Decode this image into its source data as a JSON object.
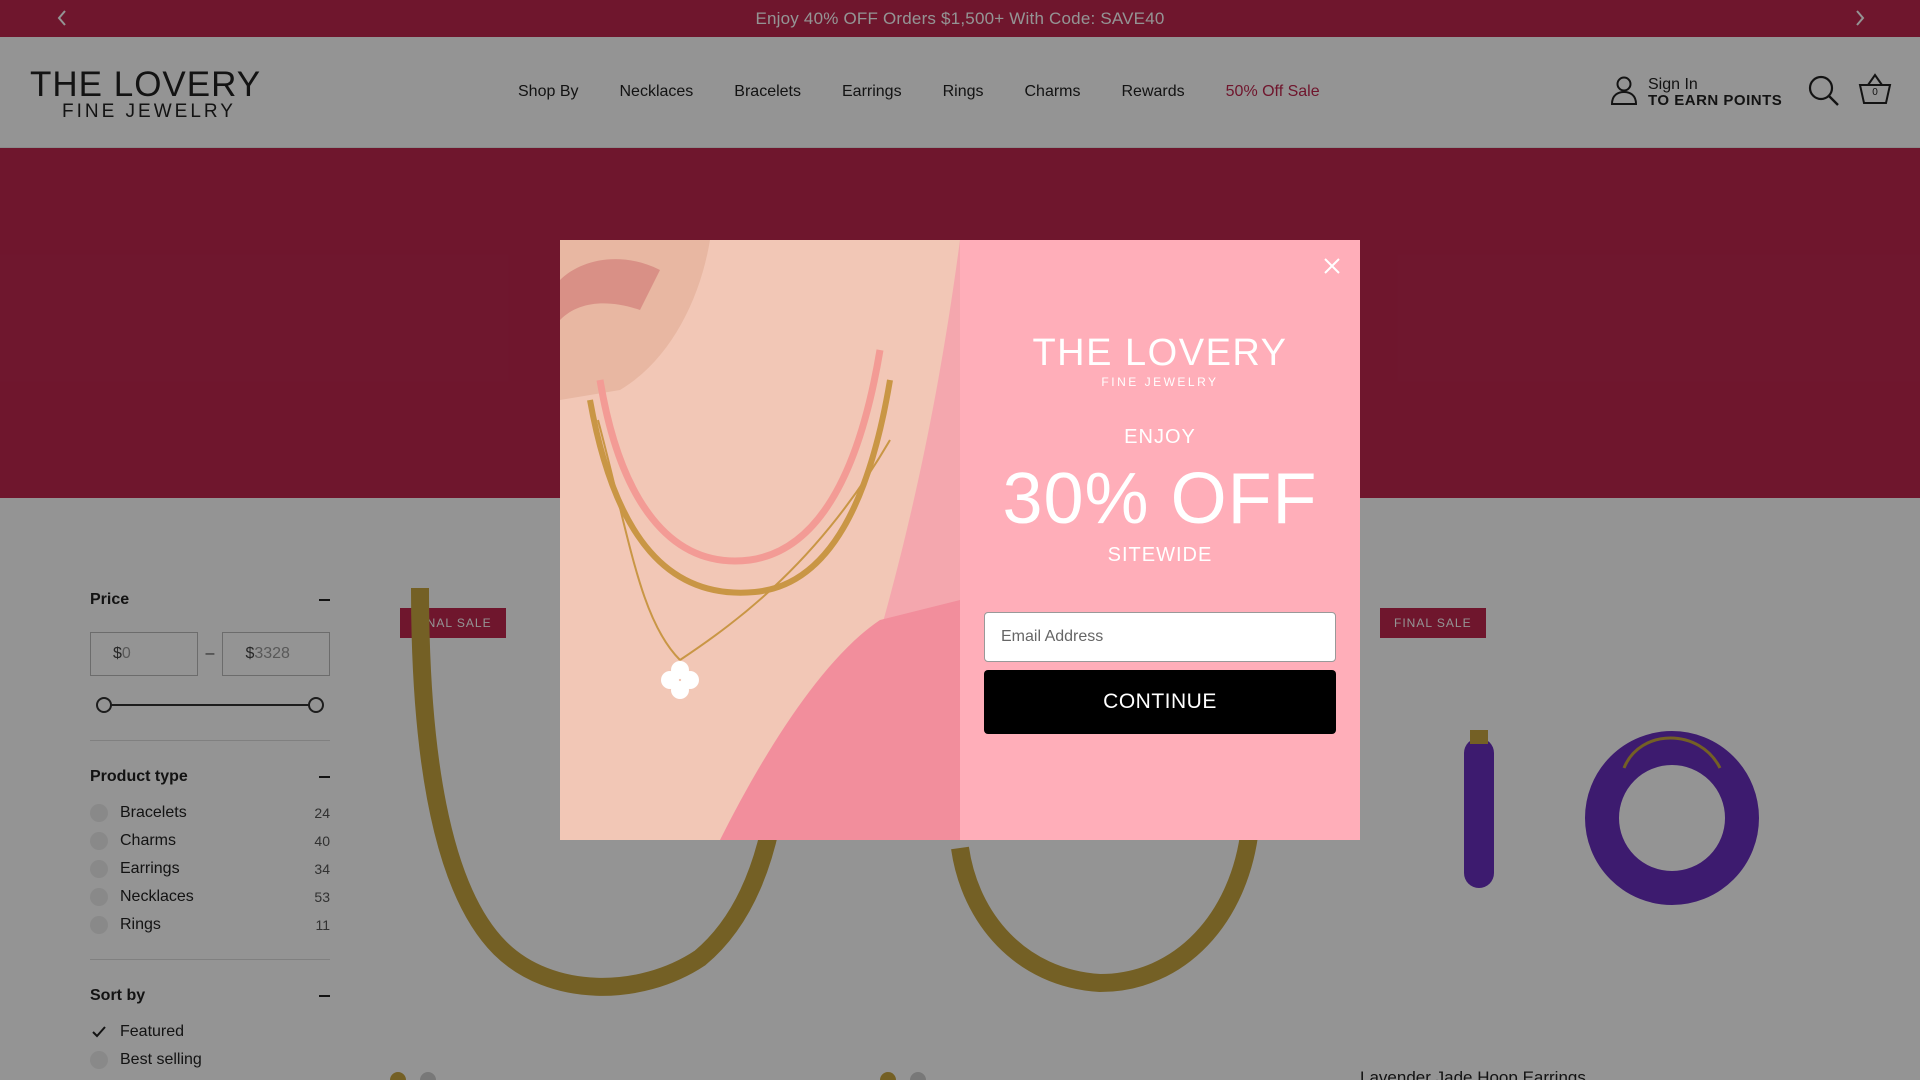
{
  "announcement": {
    "text": "Enjoy 40% OFF Orders $1,500+ With Code: SAVE40",
    "prev_icon": "chevron-left-icon",
    "next_icon": "chevron-right-icon"
  },
  "header": {
    "logo_main": "THE LOVERY",
    "logo_sub": "FINE JEWELRY",
    "nav": [
      {
        "label": "Shop By"
      },
      {
        "label": "Necklaces"
      },
      {
        "label": "Bracelets"
      },
      {
        "label": "Earrings"
      },
      {
        "label": "Rings"
      },
      {
        "label": "Charms"
      },
      {
        "label": "Rewards"
      },
      {
        "label": "50% Off Sale"
      }
    ],
    "account_line1": "Sign In",
    "account_line2": "TO EARN POINTS",
    "cart_count": "0"
  },
  "filters": {
    "price": {
      "title": "Price",
      "currency": "$",
      "min_placeholder": "0",
      "max_placeholder": "3328",
      "separator": "–"
    },
    "product_type": {
      "title": "Product type",
      "options": [
        {
          "label": "Bracelets",
          "count": "24"
        },
        {
          "label": "Charms",
          "count": "40"
        },
        {
          "label": "Earrings",
          "count": "34"
        },
        {
          "label": "Necklaces",
          "count": "53"
        },
        {
          "label": "Rings",
          "count": "11"
        }
      ]
    },
    "sort_by": {
      "title": "Sort by",
      "options": [
        {
          "label": "Featured",
          "selected": true
        },
        {
          "label": "Best selling",
          "selected": false
        }
      ]
    }
  },
  "products": [
    {
      "badge": "FINAL SALE",
      "title": ""
    },
    {
      "badge": "",
      "title": ""
    },
    {
      "badge": "FINAL SALE",
      "title": "Lavender Jade Hoop Earrings"
    }
  ],
  "modal": {
    "logo_main": "THE LOVERY",
    "logo_sub": "FINE JEWELRY",
    "enjoy": "ENJOY",
    "offer": "30% OFF",
    "sitewide": "SITEWIDE",
    "email_placeholder": "Email Address",
    "continue_label": "CONTINUE"
  },
  "colors": {
    "brand": "#c0274f",
    "modal_bg": "#ffaeb9",
    "button": "#000000"
  }
}
